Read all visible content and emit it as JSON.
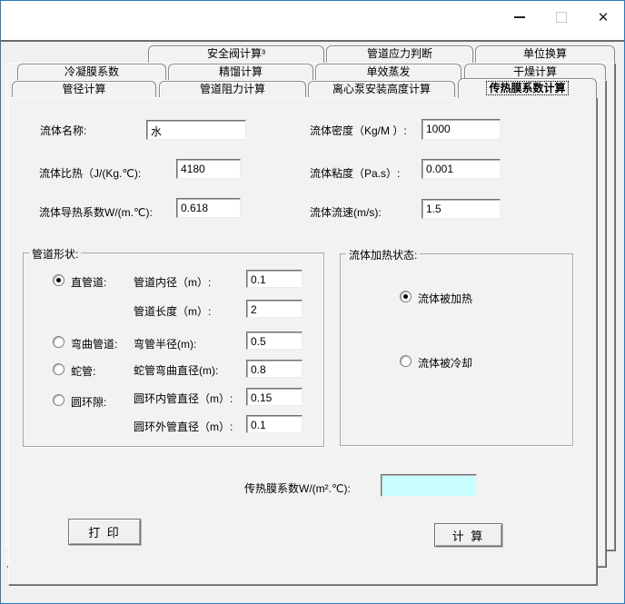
{
  "titlebar": {
    "close_glyph": "✕"
  },
  "tabs": {
    "row1": [
      "安全阀计算³",
      "管道应力判断",
      "单位换算"
    ],
    "row2": [
      "冷凝膜系数",
      "精馏计算",
      "单效蒸发",
      "干燥计算"
    ],
    "row3": [
      "管径计算",
      "管道阻力计算",
      "离心泵安装高度计算",
      "传热膜系数计算"
    ],
    "selected": "传热膜系数计算"
  },
  "fluid_fields": {
    "name": {
      "label": "流体名称:",
      "value": "水"
    },
    "density": {
      "label": "流体密度（Kg/M ）:",
      "value": "1000"
    },
    "specific_heat": {
      "label": "流体比热（J/(Kg.℃):",
      "value": "4180"
    },
    "viscosity": {
      "label": "流体粘度（Pa.s）:",
      "value": "0.001"
    },
    "conductivity": {
      "label": "流体导热系数W/(m.℃):",
      "value": "0.618"
    },
    "velocity": {
      "label": "流体流速(m/s):",
      "value": "1.5"
    }
  },
  "pipe_shape": {
    "group_label": "管道形状:",
    "straight": {
      "label": "直管道:",
      "selected": true
    },
    "inner_diameter": {
      "label": "管道内径（m）:",
      "value": "0.1"
    },
    "length": {
      "label": "管道长度（m）:",
      "value": "2"
    },
    "curved": {
      "label": "弯曲管道:",
      "selected": false
    },
    "bend_radius": {
      "label": "弯管半径(m):",
      "value": "0.5"
    },
    "coil": {
      "label": "蛇管:",
      "selected": false
    },
    "coil_diameter": {
      "label": "蛇管弯曲直径(m):",
      "value": "0.8"
    },
    "annulus": {
      "label": "圆环隙:",
      "selected": false
    },
    "annulus_inner": {
      "label": "圆环内管直径（m）:",
      "value": "0.15"
    },
    "annulus_outer": {
      "label": "圆环外管直径（m）:",
      "value": "0.1"
    }
  },
  "heating_state": {
    "group_label": "流体加热状态:",
    "heated": {
      "label": "流体被加热",
      "selected": true
    },
    "cooled": {
      "label": "流体被冷却",
      "selected": false
    }
  },
  "result": {
    "label": "传热膜系数W/(m².℃):",
    "value": ""
  },
  "buttons": {
    "print": "打  印",
    "calculate": "计  算"
  },
  "colors": {
    "window_border": "#2a7cc0",
    "result_bg": "#c8feff"
  }
}
